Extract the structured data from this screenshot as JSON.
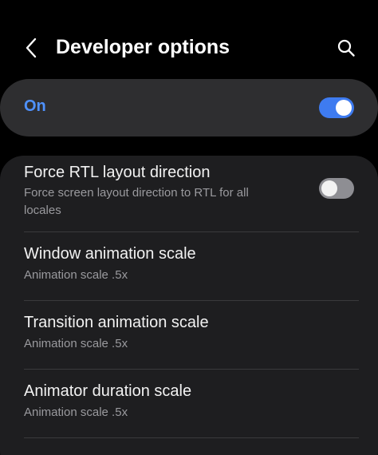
{
  "header": {
    "title": "Developer options",
    "back_icon": "chevron-left-icon",
    "search_icon": "search-icon"
  },
  "master_switch": {
    "label": "On",
    "state": "on",
    "accent_color": "#3e7bf0"
  },
  "settings": [
    {
      "title": "Force RTL layout direction",
      "summary": "Force screen layout direction to RTL for all locales",
      "toggle_state": "off"
    },
    {
      "title": "Window animation scale",
      "summary": "Animation scale .5x"
    },
    {
      "title": "Transition animation scale",
      "summary": "Animation scale .5x"
    },
    {
      "title": "Animator duration scale",
      "summary": "Animation scale .5x"
    }
  ]
}
